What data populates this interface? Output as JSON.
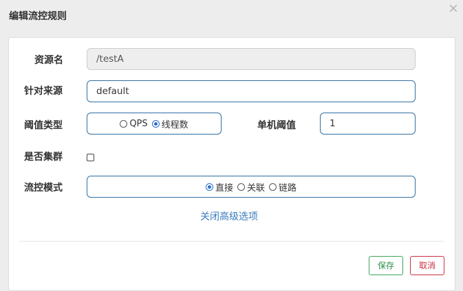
{
  "dialog": {
    "title": "编辑流控规则",
    "close_glyph": "×"
  },
  "form": {
    "resource_name": {
      "label": "资源名",
      "value": "/testA"
    },
    "limit_app": {
      "label": "针对来源",
      "value": "default"
    },
    "threshold_type": {
      "label": "阈值类型",
      "options": [
        {
          "label": "QPS",
          "checked": false
        },
        {
          "label": "线程数",
          "checked": true
        }
      ]
    },
    "single_threshold": {
      "label": "单机阈值",
      "value": "1"
    },
    "cluster": {
      "label": "是否集群",
      "checked": false
    },
    "control_mode": {
      "label": "流控模式",
      "options": [
        {
          "label": "直接",
          "checked": true
        },
        {
          "label": "关联",
          "checked": false
        },
        {
          "label": "链路",
          "checked": false
        }
      ]
    },
    "advanced_toggle": "关闭高级选项"
  },
  "footer": {
    "save_label": "保存",
    "cancel_label": "取消"
  },
  "colors": {
    "input_border": "#2f6ea0",
    "link": "#3a7bbf",
    "save": "#3aa35b",
    "cancel": "#c9303f"
  }
}
